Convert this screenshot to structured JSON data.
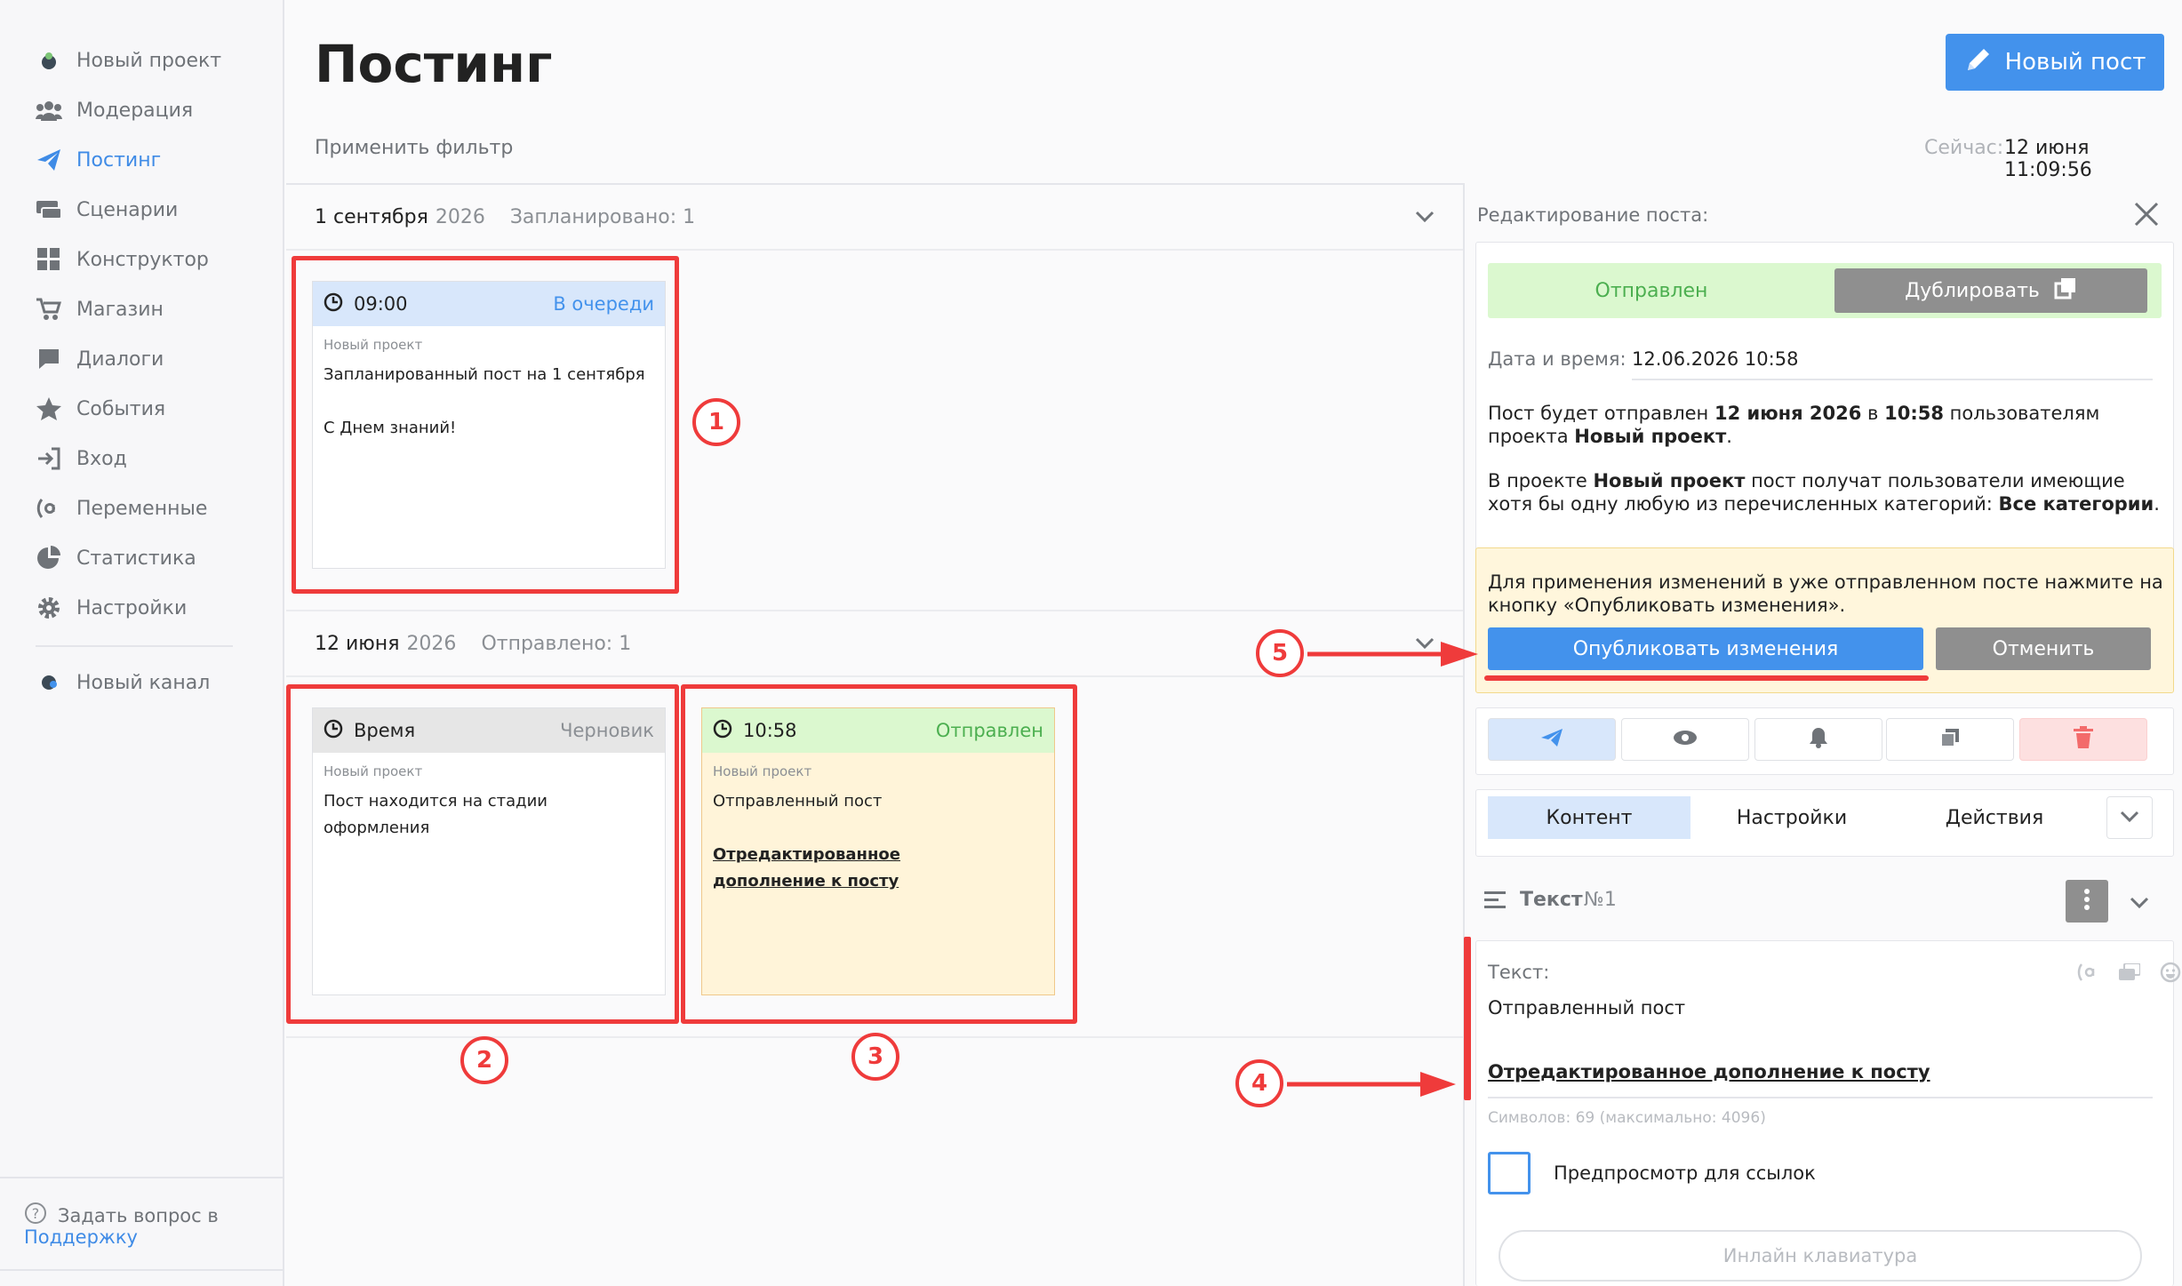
{
  "sidebar": {
    "items": [
      {
        "label": "Новый проект",
        "icon": "project-avatar-icon"
      },
      {
        "label": "Модерация",
        "icon": "users-icon"
      },
      {
        "label": "Постинг",
        "icon": "paper-plane-icon"
      },
      {
        "label": "Сценарии",
        "icon": "scenario-icon"
      },
      {
        "label": "Конструктор",
        "icon": "grid-icon"
      },
      {
        "label": "Магазин",
        "icon": "cart-icon"
      },
      {
        "label": "Диалоги",
        "icon": "chat-icon"
      },
      {
        "label": "События",
        "icon": "star-icon"
      },
      {
        "label": "Вход",
        "icon": "sign-in-icon"
      },
      {
        "label": "Переменные",
        "icon": "variable-icon"
      },
      {
        "label": "Статистика",
        "icon": "pie-chart-icon"
      },
      {
        "label": "Настройки",
        "icon": "gear-icon"
      }
    ],
    "channel": "Новый канал",
    "help_text": "Задать вопрос в",
    "help_link": "Поддержку"
  },
  "header": {
    "title": "Постинг",
    "new_post": "Новый пост",
    "filter": "Применить фильтр",
    "now_label": "Сейчас:",
    "now_value": "12 июня 11:09:56"
  },
  "groups": [
    {
      "date": "1 сентября",
      "year": "2026",
      "stat": "Запланировано: 1"
    },
    {
      "date": "12 июня",
      "year": "2026",
      "stat": "Отправлено: 1"
    }
  ],
  "cards": {
    "c1": {
      "time": "09:00",
      "status": "В очереди",
      "project": "Новый проект",
      "line1": "Запланированный пост на 1 сентября",
      "line2": "С Днем знаний!"
    },
    "c2": {
      "time": "Время",
      "status": "Черновик",
      "project": "Новый проект",
      "line1": "Пост находится на стадии оформления"
    },
    "c3": {
      "time": "10:58",
      "status": "Отправлен",
      "project": "Новый проект",
      "line1": "Отправленный пост",
      "line2": "Отредактированное дополнение к посту"
    }
  },
  "badges": [
    "1",
    "2",
    "3",
    "4",
    "5"
  ],
  "panel": {
    "title": "Редактирование поста:",
    "sent": "Отправлен",
    "duplicate": "Дублировать",
    "datetime_label": "Дата и время:",
    "datetime_value": "12.06.2026 10:58",
    "info1_a": "Пост будет отправлен ",
    "info1_b": "12 июня 2026",
    "info1_c": " в ",
    "info1_d": "10:58",
    "info1_e": " пользователям проекта ",
    "info1_f": "Новый проект",
    "info1_g": ".",
    "info2_a": "В проекте ",
    "info2_b": "Новый проект",
    "info2_c": " пост получат пользователи имеющие хотя бы одну любую из перечисленных категорий: ",
    "info2_d": "Все категории",
    "info2_e": ".",
    "warning": "Для применения изменений в уже отправленном посте нажмите на кнопку «Опубликовать изменения».",
    "publish": "Опубликовать изменения",
    "cancel": "Отменить",
    "tabs": [
      "Контент",
      "Настройки",
      "Действия"
    ],
    "block_title": "Текст",
    "block_num": "№1",
    "text_label": "Текст:",
    "text_line1": "Отправленный пост",
    "text_line2": "Отредактированное дополнение к посту",
    "counter": "Символов: 69 (максимально: 4096)",
    "preview": "Предпросмотр для ссылок",
    "inline_kb": "Инлайн клавиатура"
  },
  "colors": {
    "accent": "#4392ec",
    "sent_green": "#4caf50",
    "annotation_red": "#ef3b3b",
    "warning_bg": "#fff6dc"
  }
}
